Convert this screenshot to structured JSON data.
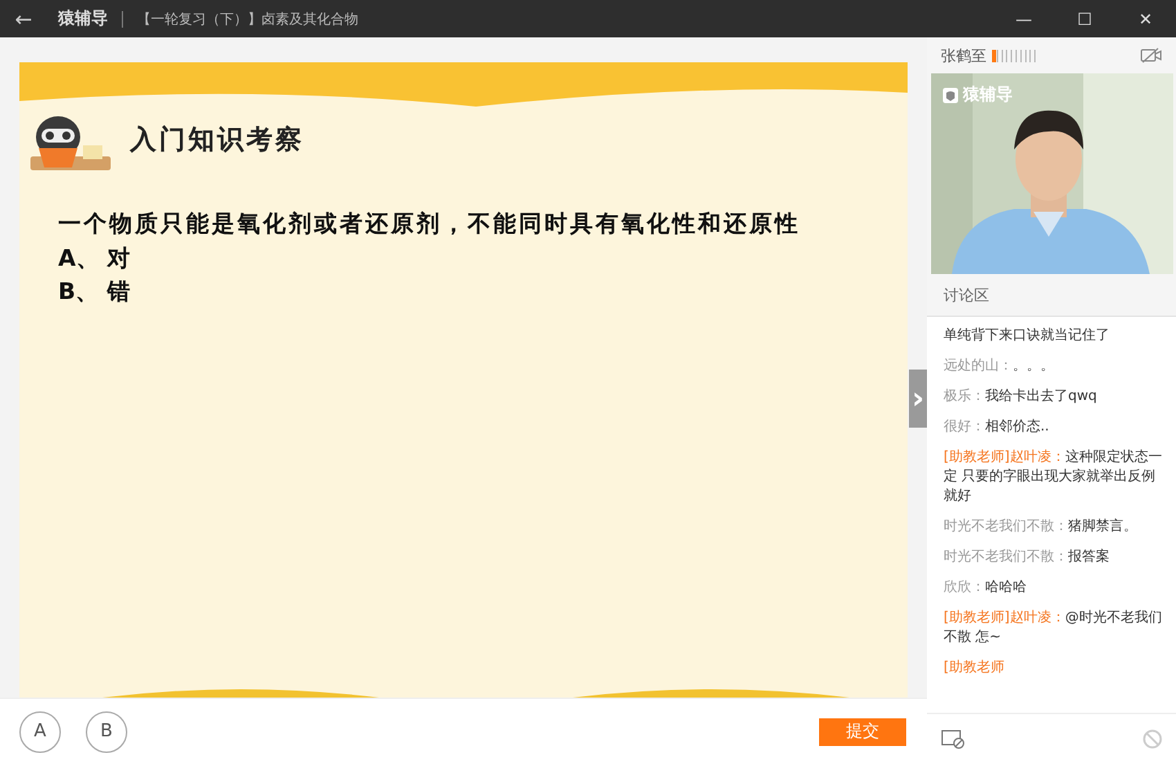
{
  "window": {
    "back": "←",
    "app": "猿辅导",
    "title": "【一轮复习（下）】卤素及其化合物",
    "controls": [
      "—",
      "☐",
      "✕"
    ]
  },
  "slide": {
    "heading": "入门知识考察",
    "question": "一个物质只能是氧化剂或者还原剂，不能同时具有氧化性和还原性",
    "options": [
      "A、 对",
      "B、 错"
    ]
  },
  "answer_bar": {
    "choices": [
      {
        "label": "A",
        "selected": false
      },
      {
        "label": "B",
        "selected": false
      }
    ],
    "submit": "提交"
  },
  "expand_handle": "›",
  "teacher": {
    "name": "张鹤至",
    "mic": {
      "level": 0.1
    },
    "video_logo": "猿辅导"
  },
  "discussion": {
    "title": "讨论区",
    "messages": [
      {
        "kind": "student",
        "text": "单纯背下来口诀就当记住了"
      },
      {
        "kind": "student",
        "sender": "远处的山：",
        "text": "。。。"
      },
      {
        "kind": "student",
        "sender": "极乐：",
        "text": "我给卡出去了qwq"
      },
      {
        "kind": "student",
        "sender": "很好：",
        "text": "相邻价态.."
      },
      {
        "kind": "assistant",
        "sender": "[助教老师]赵叶凌：",
        "text": "这种限定状态一定 只要的字眼出现大家就举出反例就好"
      },
      {
        "kind": "student",
        "sender": "时光不老我们不散：",
        "text": "猪脚禁言。"
      },
      {
        "kind": "student",
        "sender": "时光不老我们不散：",
        "text": "报答案"
      },
      {
        "kind": "student",
        "sender": "欣欣：",
        "text": "哈哈哈"
      },
      {
        "kind": "assistant",
        "sender": "[助教老师]赵叶凌：",
        "text": "@时光不老我们不散 怎~"
      },
      {
        "kind": "assistant",
        "sender": "[助教老师"
      }
    ]
  }
}
